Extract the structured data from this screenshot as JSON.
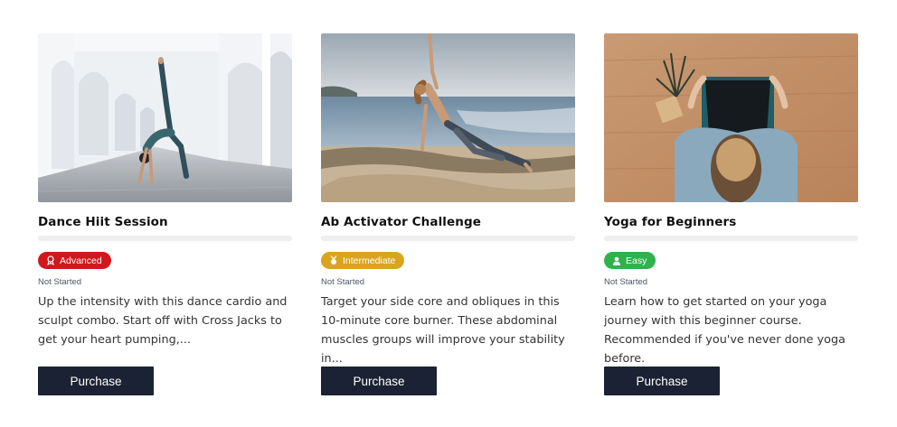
{
  "courses": [
    {
      "title": "Dance Hiit Session",
      "level": "Advanced",
      "level_icon": "medal-icon",
      "level_color": "#d0181d",
      "progress_percent": 0,
      "status": "Not Started",
      "description": "Up the intensity with this dance cardio and sculpt combo. Start off with Cross Jacks to get your heart pumping,...",
      "button_label": "Purchase"
    },
    {
      "title": "Ab Activator Challenge",
      "level": "Intermediate",
      "level_icon": "medal-icon",
      "level_color": "#d9a51f",
      "progress_percent": 0,
      "status": "Not Started",
      "description": "Target your side core and obliques in this 10-minute core burner. These abdominal muscles groups will improve your stability in...",
      "button_label": "Purchase"
    },
    {
      "title": "Yoga for Beginners",
      "level": "Easy",
      "level_icon": "person-icon",
      "level_color": "#2fb24c",
      "progress_percent": 0,
      "status": "Not Started",
      "description": "Learn how to get started on your yoga journey with this beginner course. Recommended if you've never done yoga before.",
      "button_label": "Purchase"
    }
  ],
  "colors": {
    "button_bg": "#1a2233",
    "progress_track": "#eeeeee"
  }
}
